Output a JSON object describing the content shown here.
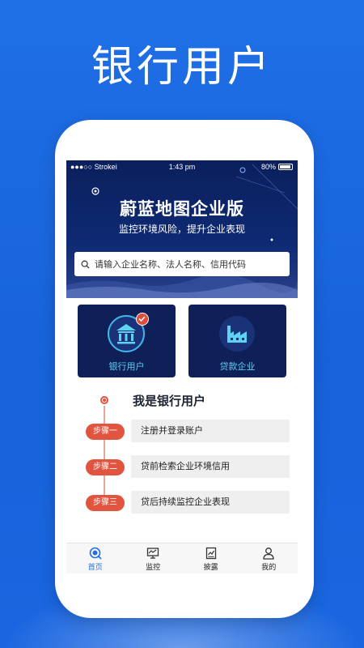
{
  "promo": {
    "title": "银行用户"
  },
  "status_bar": {
    "carrier": "●●●○○ Strokei",
    "time": "1:43 pm",
    "battery": "80%"
  },
  "hero": {
    "title": "蔚蓝地图企业版",
    "subtitle": "监控环境风险，提升企业表现",
    "search_placeholder": "请输入企业名称、法人名称、信用代码"
  },
  "cards": [
    {
      "label": "银行用户",
      "icon": "bank-icon",
      "selected": true
    },
    {
      "label": "贷款企业",
      "icon": "factory-icon",
      "selected": false
    }
  ],
  "section": {
    "title": "我是银行用户"
  },
  "steps": [
    {
      "badge": "步骤一",
      "text": "注册并登录账户"
    },
    {
      "badge": "步骤二",
      "text": "贷前检索企业环境信用"
    },
    {
      "badge": "步骤三",
      "text": "贷后持续监控企业表现"
    }
  ],
  "tabs": [
    {
      "label": "首页",
      "icon": "home-search-icon",
      "active": true
    },
    {
      "label": "监控",
      "icon": "monitor-icon",
      "active": false
    },
    {
      "label": "披露",
      "icon": "disclosure-icon",
      "active": false
    },
    {
      "label": "我的",
      "icon": "user-icon",
      "active": false
    }
  ],
  "colors": {
    "accent": "#1f6fe6",
    "step_red": "#e05440",
    "card_bg": "#0f1f57",
    "card_text": "#5fd1f2"
  }
}
